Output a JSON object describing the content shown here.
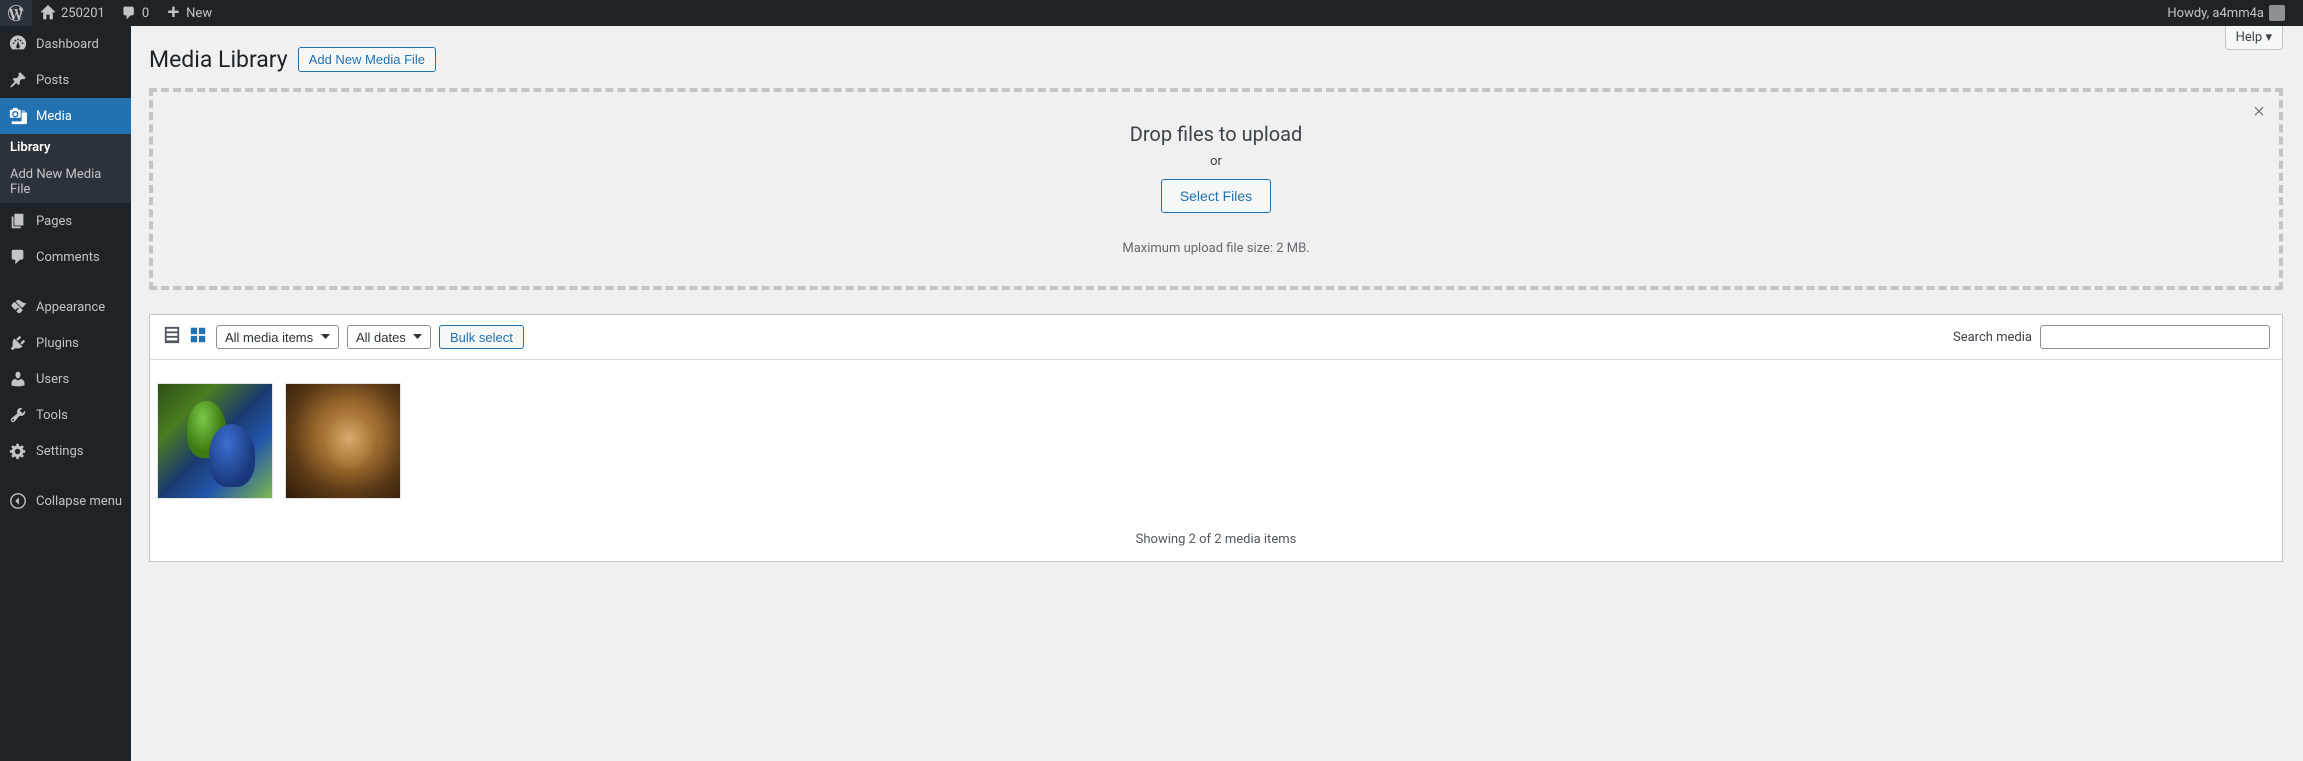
{
  "adminbar": {
    "site_name": "250201",
    "comments_count": "0",
    "new_label": "New",
    "howdy": "Howdy, a4mm4a"
  },
  "sidebar": {
    "items": [
      {
        "label": "Dashboard"
      },
      {
        "label": "Posts"
      },
      {
        "label": "Media"
      },
      {
        "label": "Pages"
      },
      {
        "label": "Comments"
      },
      {
        "label": "Appearance"
      },
      {
        "label": "Plugins"
      },
      {
        "label": "Users"
      },
      {
        "label": "Tools"
      },
      {
        "label": "Settings"
      },
      {
        "label": "Collapse menu"
      }
    ],
    "submenu": {
      "library": "Library",
      "add_new": "Add New Media File"
    }
  },
  "header": {
    "title": "Media Library",
    "add_new": "Add New Media File",
    "help": "Help"
  },
  "upload": {
    "title": "Drop files to upload",
    "or": "or",
    "select_files": "Select Files",
    "max_hint": "Maximum upload file size: 2 MB."
  },
  "toolbar": {
    "filter_type": "All media items",
    "filter_date": "All dates",
    "bulk_select": "Bulk select",
    "search_label": "Search media",
    "search_placeholder": ""
  },
  "footer": {
    "showing": "Showing 2 of 2 media items"
  }
}
